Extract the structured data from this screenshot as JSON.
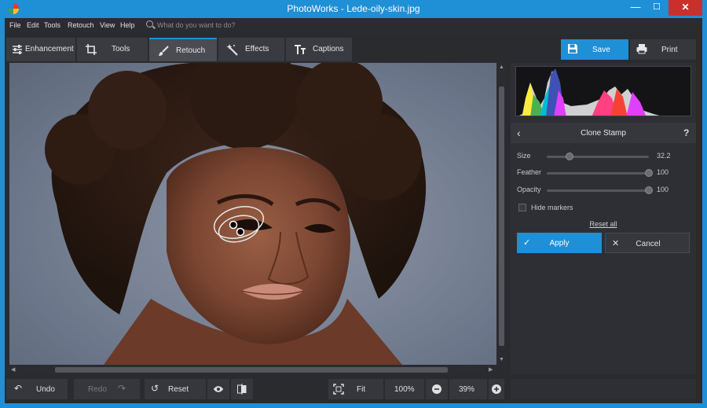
{
  "window": {
    "title": "PhotoWorks - Lede-oily-skin.jpg",
    "minimize": "—",
    "maximize": "☐",
    "close": "✕"
  },
  "menu": {
    "items": [
      "File",
      "Edit",
      "Tools",
      "Retouch",
      "View",
      "Help"
    ],
    "search_placeholder": "What do you want to do?"
  },
  "toolbar": {
    "tabs": [
      {
        "label": "Enhancement",
        "icon": "sliders-icon"
      },
      {
        "label": "Tools",
        "icon": "crop-icon"
      },
      {
        "label": "Retouch",
        "icon": "brush-icon",
        "active": true
      },
      {
        "label": "Effects",
        "icon": "magic-wand-icon"
      },
      {
        "label": "Captions",
        "icon": "text-icon"
      }
    ],
    "save_label": "Save",
    "print_label": "Print"
  },
  "panel": {
    "title": "Clone Stamp",
    "help": "?",
    "sliders": [
      {
        "label": "Size",
        "value": "32.2",
        "level": 0.22
      },
      {
        "label": "Feather",
        "value": "100",
        "level": 1.0
      },
      {
        "label": "Opacity",
        "value": "100",
        "level": 1.0
      }
    ],
    "hide_markers_label": "Hide markers",
    "hide_markers_checked": false,
    "reset_all_label": "Reset all",
    "apply_label": "Apply",
    "cancel_label": "Cancel"
  },
  "bottom": {
    "undo_label": "Undo",
    "redo_label": "Redo",
    "reset_label": "Reset",
    "fit_label": "Fit",
    "zoom_100_label": "100%",
    "zoom_value": "39%"
  },
  "colors": {
    "accent": "#1f8fd6",
    "close": "#c9302c",
    "bg": "#2a2b2f"
  }
}
